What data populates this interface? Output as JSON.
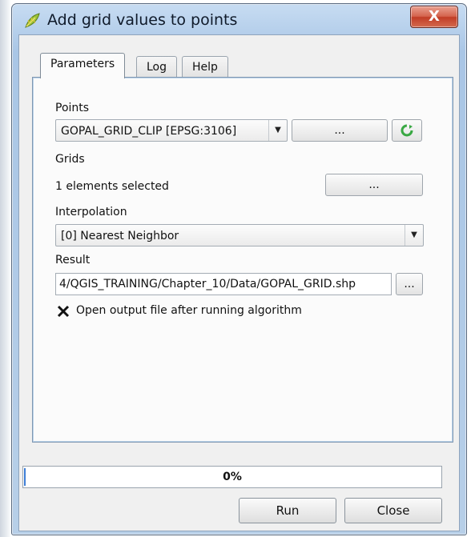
{
  "window": {
    "title": "Add grid values to points",
    "close_glyph": "X"
  },
  "tabs": [
    {
      "label": "Parameters",
      "active": true
    },
    {
      "label": "Log",
      "active": false
    },
    {
      "label": "Help",
      "active": false
    }
  ],
  "params": {
    "points_label": "Points",
    "points_value": "GOPAL_GRID_CLIP [EPSG:3106]",
    "points_browse": "...",
    "grids_label": "Grids",
    "grids_value": "1 elements selected",
    "grids_browse": "...",
    "interp_label": "Interpolation",
    "interp_value": "[0] Nearest Neighbor",
    "result_label": "Result",
    "result_value": "4/QGIS_TRAINING/Chapter_10/Data/GOPAL_GRID.shp",
    "result_browse": "...",
    "open_output_label": "Open output file after running algorithm",
    "open_output_checked": true
  },
  "progress": {
    "value": 0,
    "text": "0%"
  },
  "buttons": {
    "run": "Run",
    "close": "Close"
  },
  "colors": {
    "accent": "#4a90e2",
    "close_red": "#c13c25",
    "refresh_green": "#39a843"
  },
  "icons": {
    "app": "qgis-leaf-icon",
    "refresh": "refresh-icon",
    "dropdown": "chevron-down-icon"
  }
}
